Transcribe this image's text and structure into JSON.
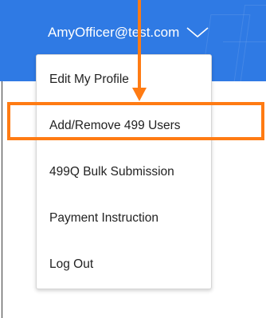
{
  "header": {
    "user_email": "AmyOfficer@test.com",
    "background_color": "#2f7ae4",
    "dropdown_icon": "chevron-down-icon"
  },
  "dropdown": {
    "items": [
      {
        "label": "Edit My Profile"
      },
      {
        "label": "Add/Remove 499 Users"
      },
      {
        "label": "499Q Bulk Submission"
      },
      {
        "label": "Payment Instruction"
      },
      {
        "label": "Log Out"
      }
    ],
    "highlighted_index": 1
  },
  "annotation": {
    "color": "#ff7b13",
    "arrow_icon": "arrow-down-icon"
  }
}
